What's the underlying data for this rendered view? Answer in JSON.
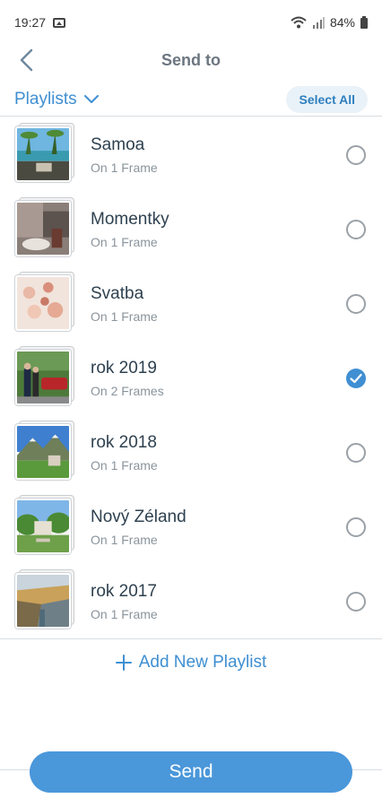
{
  "status_bar": {
    "time": "19:27",
    "battery": "84%"
  },
  "header": {
    "title": "Send to"
  },
  "toolbar": {
    "dropdown_label": "Playlists",
    "select_all_label": "Select All"
  },
  "playlists": [
    {
      "title": "Samoa",
      "subtitle": "On 1 Frame",
      "checked": false
    },
    {
      "title": "Momentky",
      "subtitle": "On 1 Frame",
      "checked": false
    },
    {
      "title": "Svatba",
      "subtitle": "On 1 Frame",
      "checked": false
    },
    {
      "title": "rok 2019",
      "subtitle": "On 2 Frames",
      "checked": true
    },
    {
      "title": "rok 2018",
      "subtitle": "On 1 Frame",
      "checked": false
    },
    {
      "title": "Nový Zéland",
      "subtitle": "On 1 Frame",
      "checked": false
    },
    {
      "title": "rok 2017",
      "subtitle": "On 1 Frame",
      "checked": false
    }
  ],
  "add_playlist_label": "Add New Playlist",
  "send_label": "Send",
  "colors": {
    "accent": "#3f8fd2",
    "send_button": "#4a97da",
    "title_text": "#2e4150"
  }
}
